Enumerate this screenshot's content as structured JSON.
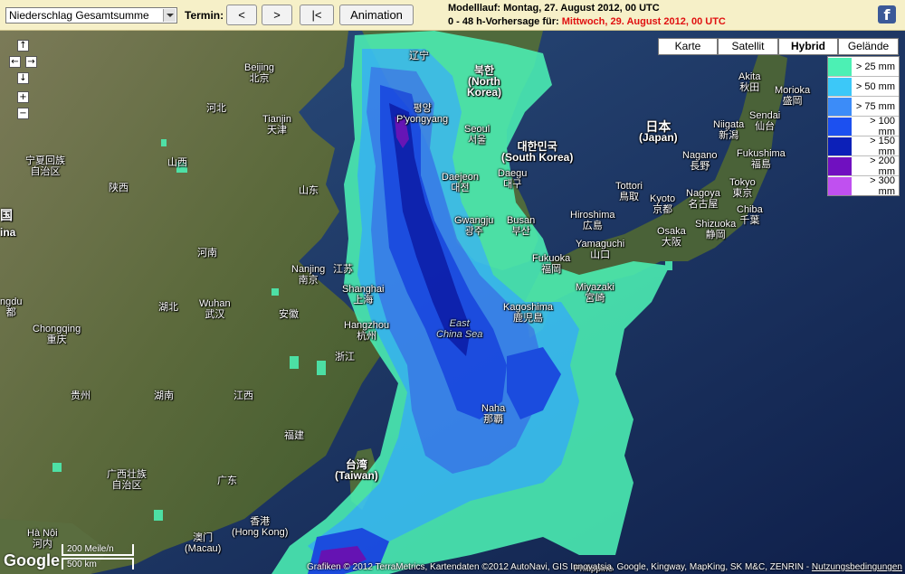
{
  "toolbar": {
    "product_select": "Niederschlag Gesamtsumme",
    "termin_label": "Termin:",
    "btn_prev": "<",
    "btn_next": ">",
    "btn_first": "|<",
    "btn_animation": "Animation",
    "model_run_label": "Modelllauf: Montag, 27. August 2012, 00 UTC",
    "forecast_prefix": "0 - 48 h-Vorhersage für:",
    "forecast_date": "Mittwoch, 29. August 2012, 00 UTC",
    "facebook_icon": "f"
  },
  "map_types": [
    "Karte",
    "Satellit",
    "Hybrid",
    "Gelände"
  ],
  "map_type_active": "Hybrid",
  "legend": [
    {
      "label": "> 25 mm",
      "color": "#4cf0b4"
    },
    {
      "label": "> 50 mm",
      "color": "#3cc8f8"
    },
    {
      "label": "> 75 mm",
      "color": "#3c8cf8"
    },
    {
      "label": "> 100 mm",
      "color": "#1c50f0"
    },
    {
      "label": "> 150 mm",
      "color": "#0c20b8"
    },
    {
      "label": "> 200 mm",
      "color": "#7010c0"
    },
    {
      "label": "> 300 mm",
      "color": "#c050f0"
    }
  ],
  "nav_controls": {
    "up": "↑",
    "left": "←",
    "right": "→",
    "down": "↓",
    "zoom_in": "+",
    "zoom_out": "−"
  },
  "labels": {
    "beijing": "Beijing",
    "beijing_zh": "北京",
    "tianjin": "Tianjin",
    "tianjin_zh": "天津",
    "hebei": "河北",
    "shanxi": "山西",
    "shaanxi": "陕西",
    "shandong": "山东",
    "henan": "河南",
    "ningxia_1": "宁夏回族",
    "ningxia_2": "自治区",
    "guo": "国",
    "ina": "ina",
    "nanjing": "Nanjing",
    "jiangsu": "江苏",
    "nanjing_zh": "南京",
    "shanghai": "Shanghai",
    "shanghai_zh": "上海",
    "wuhan": "Wuhan",
    "wuhan_zh": "武汉",
    "hubei": "湖北",
    "anhui": "安徽",
    "hangzhou": "Hangzhou",
    "hangzhou_zh": "杭州",
    "zhejiang": "浙江",
    "jiangxi": "江西",
    "hunan": "湖南",
    "guizhou": "贵州",
    "fujian": "福建",
    "chengdu": "ngdu",
    "chengdu_zh": "都",
    "chongqing": "Chongqing",
    "chongqing_zh": "重庆",
    "guangxi_1": "广西壮族",
    "guangxi_2": "自治区",
    "guangdong": "广东",
    "hong_kong_zh": "香港",
    "hong_kong": "(Hong Kong)",
    "macau_zh": "澳门",
    "macau": "(Macau)",
    "hanoi": "Hà Nội",
    "hanoi_zh": "河内",
    "taiwan_zh": "台湾",
    "taiwan": "(Taiwan)",
    "naha": "Naha",
    "naha_zh": "那覇",
    "east_china_sea_1": "East",
    "east_china_sea_2": "China Sea",
    "liaoning": "辽宁",
    "north_korea_zh": "북한",
    "north_korea": "(North",
    "north_korea_2": "Korea)",
    "pyongyang_zh": "평양",
    "pyongyang": "P'yongyang",
    "seoul": "Seoul",
    "seoul_zh": "서울",
    "south_korea_zh": "대한민국",
    "south_korea": "(South Korea)",
    "daejeon": "Daejeon",
    "daejeon_zh": "대전",
    "daegu": "Daegu",
    "daegu_zh": "대구",
    "gwangju": "Gwangju",
    "gwangju_zh": "광주",
    "busan": "Busan",
    "busan_zh": "부산",
    "japan_zh": "日本",
    "japan": "(Japan)",
    "fukuoka": "Fukuoka",
    "fukuoka_zh": "福岡",
    "yamaguchi": "Yamaguchi",
    "yamaguchi_zh": "山口",
    "hiroshima": "Hiroshima",
    "hiroshima_zh": "広島",
    "tottori": "Tottori",
    "tottori_zh": "鳥取",
    "kyoto": "Kyoto",
    "kyoto_zh": "京都",
    "osaka": "Osaka",
    "osaka_zh": "大阪",
    "nagoya": "Nagoya",
    "nagoya_zh": "名古屋",
    "shizuoka": "Shizuoka",
    "shizuoka_zh": "静岡",
    "nagano": "Nagano",
    "nagano_zh": "長野",
    "niigata": "Niigata",
    "niigata_zh": "新潟",
    "fukushima": "Fukushima",
    "fukushima_zh": "福島",
    "tokyo": "Tokyo",
    "tokyo_zh": "東京",
    "chiba": "Chiba",
    "chiba_zh": "千葉",
    "sendai": "Sendai",
    "sendai_zh": "仙台",
    "akita": "Akita",
    "akita_zh": "秋田",
    "morioka": "Morioka",
    "morioka_zh": "盛岡",
    "miyazaki": "Miyazaki",
    "miyazaki_zh": "宮崎",
    "kagoshima": "Kagoshima",
    "kagoshima_zh": "鹿児島",
    "philippines": "Philippine"
  },
  "scale": {
    "miles": "200 Meile/n",
    "km": "500 km"
  },
  "google_logo": "Google",
  "copyright": "Grafiken © 2012 TerraMetrics, Kartendaten ©2012 AutoNavi, GIS Innovatsia, Google, Kingway, MapKing, SK M&C, ZENRIN -",
  "terms_link": "Nutzungsbedingungen"
}
